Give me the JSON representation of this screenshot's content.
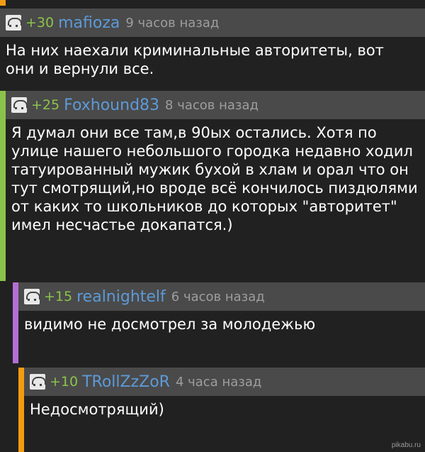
{
  "colors": {
    "background": "#212121",
    "header_bg": "#4a4a4a",
    "rating": "#8bc34a",
    "username": "#5d9ad8",
    "time": "#9e9e9e",
    "bar_level1": "#8bc34a",
    "bar_level2": "#b36fd3",
    "bar_level3": "#f39c12"
  },
  "comments": [
    {
      "rating": "+30",
      "user": "mafioza",
      "time": "9 часов назад",
      "text": "На них наехали криминальные авторитеты, вот они и вернули все."
    },
    {
      "rating": "+25",
      "user": "Foxhound83",
      "time": "8 часов назад",
      "text": "Я думал они все там,в 90ых остались. Хотя по улице нашего небольшого городка недавно ходил татуированный мужик бухой в хлам и орал что он тут смотрящий,но вроде всё кончилось пиздюлями от каких то школьников до которых \"авторитет\" имел несчастье докапатся.)"
    },
    {
      "rating": "+15",
      "user": "realnightelf",
      "time": "6 часов назад",
      "text": "видимо не досмотрел за молодежью"
    },
    {
      "rating": "+10",
      "user": "TRollZzZoR",
      "time": "4 часа назад",
      "text": "Недосмотрящий)"
    }
  ],
  "watermark": "pikabu.ru"
}
